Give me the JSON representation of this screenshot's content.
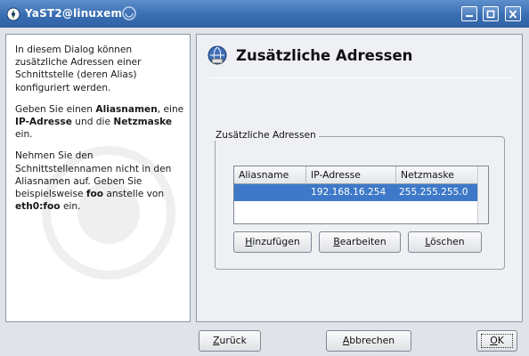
{
  "window": {
    "title": "YaST2@linuxem",
    "icons": [
      "yast-icon",
      "deco-icon",
      "minimize-icon",
      "maximize-icon",
      "close-icon"
    ]
  },
  "help": {
    "p1": "In diesem Dialog können zusätzliche Adressen einer Schnittstelle (deren Alias) konfiguriert werden.",
    "p2": [
      {
        "text": "Geben Sie einen ",
        "bold": false
      },
      {
        "text": "Aliasnamen",
        "bold": true
      },
      {
        "text": ", eine ",
        "bold": false
      },
      {
        "text": "IP-Adresse",
        "bold": true
      },
      {
        "text": " und die ",
        "bold": false
      },
      {
        "text": "Netzmaske",
        "bold": true
      },
      {
        "text": " ein.",
        "bold": false
      }
    ],
    "p3": [
      {
        "text": "Nehmen Sie den Schnittstellennamen nicht in den Aliasnamen auf. Geben Sie beispielsweise ",
        "bold": false
      },
      {
        "text": "foo",
        "bold": true
      },
      {
        "text": " anstelle von ",
        "bold": false
      },
      {
        "text": "eth0:foo",
        "bold": true
      },
      {
        "text": " ein.",
        "bold": false
      }
    ]
  },
  "main": {
    "heading": "Zusätzliche Adressen",
    "group_label": "Zusätzliche Adressen",
    "table": {
      "columns": [
        "Aliasname",
        "IP-Adresse",
        "Netzmaske"
      ],
      "rows": [
        {
          "alias": "",
          "ip": "192.168.16.254",
          "mask": "255.255.255.0",
          "selected": true
        }
      ]
    },
    "buttons": {
      "add": {
        "mnemonic": "H",
        "rest": "inzufügen"
      },
      "edit": {
        "mnemonic": "B",
        "rest": "earbeiten"
      },
      "delete": {
        "before": "",
        "mnemonic": "L",
        "rest": "öschen"
      }
    }
  },
  "footer": {
    "back": {
      "mnemonic": "Z",
      "rest": "urück"
    },
    "abort": {
      "mnemonic": "A",
      "rest": "bbrechen"
    },
    "ok": {
      "mnemonic": "O",
      "rest": "K"
    }
  },
  "colors": {
    "titlebar": "#3b6fb3",
    "selection": "#3d79c8",
    "panel_bg": "#eef0f4"
  }
}
